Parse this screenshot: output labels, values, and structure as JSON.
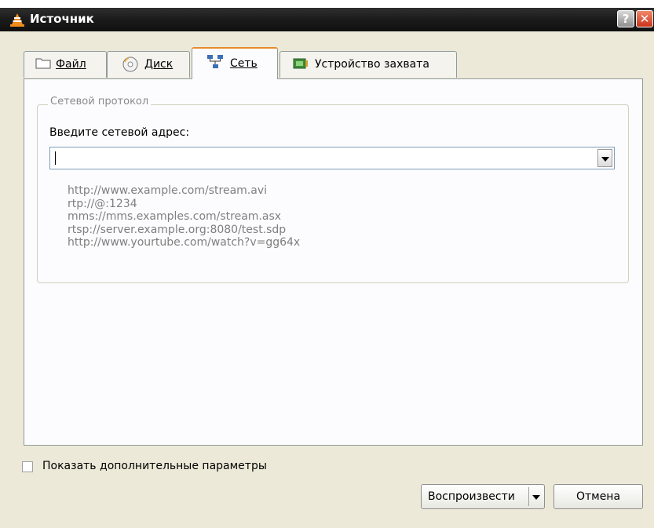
{
  "window": {
    "title": "Источник"
  },
  "tabs": [
    {
      "label": "Файл",
      "icon": "folder-icon"
    },
    {
      "label": "Диск",
      "icon": "disc-icon"
    },
    {
      "label": "Сеть",
      "icon": "network-icon",
      "active": true
    },
    {
      "label": "Устройство захвата",
      "icon": "capture-device-icon"
    }
  ],
  "network": {
    "group_title": "Сетевой протокол",
    "address_label": "Введите сетевой адрес:",
    "address_value": "",
    "examples": [
      "http://www.example.com/stream.avi",
      "rtp://@:1234",
      "mms://mms.examples.com/stream.asx",
      "rtsp://server.example.org:8080/test.sdp",
      "http://www.yourtube.com/watch?v=gg64x"
    ]
  },
  "options": {
    "show_more_label": "Показать дополнительные параметры",
    "checked": false
  },
  "buttons": {
    "play_label": "Воспроизвести",
    "cancel_label": "Отмена"
  },
  "colors": {
    "active_tab_accent": "#e68b2c",
    "dialog_bg": "#ece9d8",
    "title_bar": "#1c1c1c",
    "close_red": "#c9331b"
  }
}
